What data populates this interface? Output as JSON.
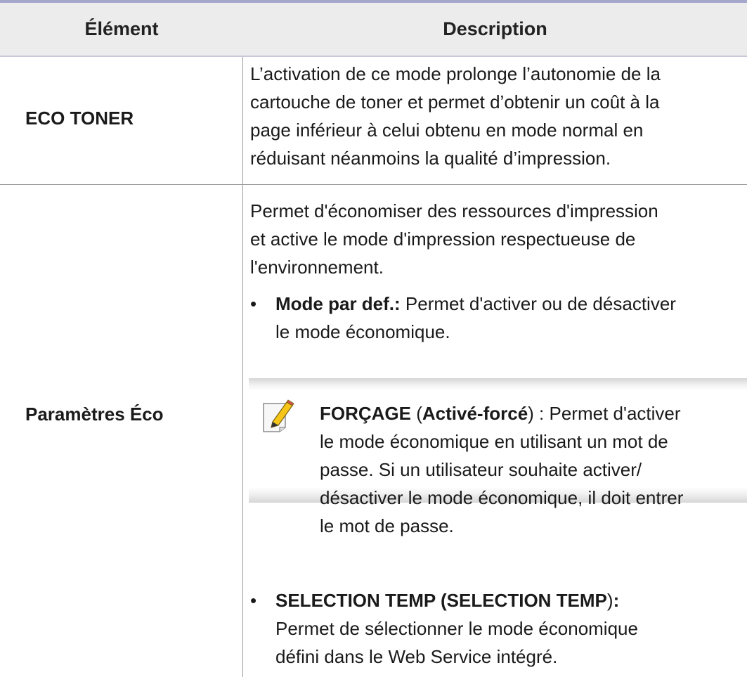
{
  "header": {
    "col_element": "Élément",
    "col_description": "Description"
  },
  "rows": [
    {
      "element": "ECO TONER",
      "description_lines": [
        "L’activation de ce mode prolonge l’autonomie de la",
        "cartouche de toner et permet d’obtenir un coût à la",
        "page inférieur à celui obtenu en mode normal en",
        "réduisant néanmoins la qualité d’impression."
      ]
    },
    {
      "element": "Paramètres Éco",
      "intro_lines": [
        "Permet d'économiser des ressources d'impression",
        "et active le mode d'impression respectueuse de",
        "l'environnement."
      ],
      "bullet1": {
        "bold": "Mode par def.:",
        "text_line1": " Permet d'activer ou de désactiver",
        "text_line2": "le mode économique."
      },
      "note": {
        "icon": "note-pencil-icon",
        "bold1": "FORÇAGE",
        "open_paren": " (",
        "bold2": "Activé-forcé",
        "line1_rest": ") : Permet d'activer",
        "lines": [
          "le mode économique en utilisant un mot de",
          "passe. Si un utilisateur souhaite activer/",
          "désactiver le mode économique, il doit entrer",
          "le mot de passe."
        ]
      },
      "bullet2": {
        "bold": "SELECTION TEMP (SELECTION TEMP",
        "after_bold": ")",
        "colon": ":",
        "lines": [
          "Permet de sélectionner le mode économique",
          "défini dans le Web Service intégré."
        ]
      }
    }
  ],
  "bullet_char": "•"
}
